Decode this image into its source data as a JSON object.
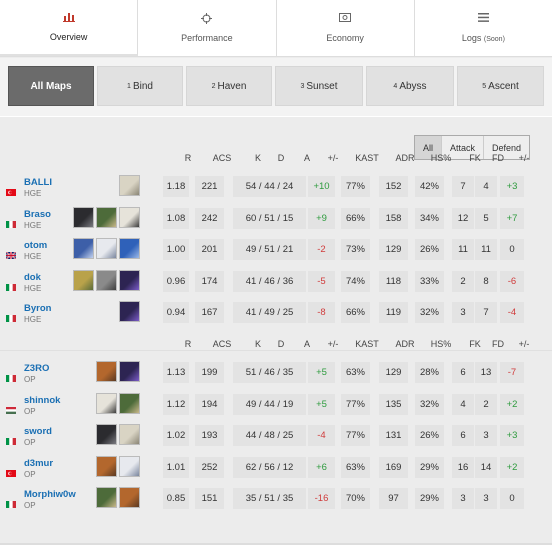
{
  "tabs": [
    {
      "label": "Overview",
      "icon": "bar-chart-icon"
    },
    {
      "label": "Performance",
      "icon": "crosshair-icon"
    },
    {
      "label": "Economy",
      "icon": "cash-icon"
    },
    {
      "label": "Logs",
      "soon": "(Soon)",
      "icon": "list-icon"
    }
  ],
  "maps": [
    {
      "num": "",
      "label": "All Maps"
    },
    {
      "num": "1",
      "label": "Bind"
    },
    {
      "num": "2",
      "label": "Haven"
    },
    {
      "num": "3",
      "label": "Sunset"
    },
    {
      "num": "4",
      "label": "Abyss"
    },
    {
      "num": "5",
      "label": "Ascent"
    }
  ],
  "filter": {
    "all": "All",
    "attack": "Attack",
    "defend": "Defend"
  },
  "columns": {
    "r": "R",
    "acs": "ACS",
    "k": "K",
    "d": "D",
    "a": "A",
    "pm": "+/-",
    "kast": "KAST",
    "adr": "ADR",
    "hs": "HS%",
    "fk": "FK",
    "fd": "FD",
    "fpm": "+/-"
  },
  "teams": [
    {
      "players": [
        {
          "name": "BALLI",
          "team": "HGE",
          "flag": "tr",
          "agents": [
            "agent-light"
          ],
          "r": "1.18",
          "acs": "221",
          "kda": "54 / 44 / 24",
          "pm": "+10",
          "kast": "77%",
          "adr": "152",
          "hs": "42%",
          "fk": "7",
          "fd": "4",
          "fpm": "+3"
        },
        {
          "name": "Braso",
          "team": "HGE",
          "flag": "it",
          "agents": [
            "agent-dark",
            "agent-green",
            "agent-mask"
          ],
          "r": "1.08",
          "acs": "242",
          "kda": "60 / 51 / 15",
          "pm": "+9",
          "kast": "66%",
          "adr": "158",
          "hs": "34%",
          "fk": "12",
          "fd": "5",
          "fpm": "+7"
        },
        {
          "name": "otom",
          "team": "HGE",
          "flag": "gb",
          "agents": [
            "agent-blue",
            "agent-white",
            "agent-blue2"
          ],
          "r": "1.00",
          "acs": "201",
          "kda": "49 / 51 / 21",
          "pm": "-2",
          "kast": "73%",
          "adr": "129",
          "hs": "26%",
          "fk": "11",
          "fd": "11",
          "fpm": "0"
        },
        {
          "name": "dok",
          "team": "HGE",
          "flag": "it",
          "agents": [
            "agent-yellow",
            "agent-grey",
            "agent-purple"
          ],
          "r": "0.96",
          "acs": "174",
          "kda": "41 / 46 / 36",
          "pm": "-5",
          "kast": "74%",
          "adr": "118",
          "hs": "33%",
          "fk": "2",
          "fd": "8",
          "fpm": "-6"
        },
        {
          "name": "Byron",
          "team": "HGE",
          "flag": "it",
          "agents": [
            "agent-purple"
          ],
          "r": "0.94",
          "acs": "167",
          "kda": "41 / 49 / 25",
          "pm": "-8",
          "kast": "66%",
          "adr": "119",
          "hs": "32%",
          "fk": "3",
          "fd": "7",
          "fpm": "-4"
        }
      ]
    },
    {
      "players": [
        {
          "name": "Z3RO",
          "team": "OP",
          "flag": "it",
          "agents": [
            "agent-orange",
            "agent-purple"
          ],
          "r": "1.13",
          "acs": "199",
          "kda": "51 / 46 / 35",
          "pm": "+5",
          "kast": "63%",
          "adr": "129",
          "hs": "28%",
          "fk": "6",
          "fd": "13",
          "fpm": "-7"
        },
        {
          "name": "shinnok",
          "team": "OP",
          "flag": "hu",
          "agents": [
            "agent-mask",
            "agent-green"
          ],
          "r": "1.12",
          "acs": "194",
          "kda": "49 / 44 / 19",
          "pm": "+5",
          "kast": "77%",
          "adr": "135",
          "hs": "32%",
          "fk": "4",
          "fd": "2",
          "fpm": "+2"
        },
        {
          "name": "sword",
          "team": "OP",
          "flag": "it",
          "agents": [
            "agent-dark",
            "agent-light"
          ],
          "r": "1.02",
          "acs": "193",
          "kda": "44 / 48 / 25",
          "pm": "-4",
          "kast": "77%",
          "adr": "131",
          "hs": "26%",
          "fk": "6",
          "fd": "3",
          "fpm": "+3"
        },
        {
          "name": "d3mur",
          "team": "OP",
          "flag": "tr",
          "agents": [
            "agent-orange",
            "agent-white"
          ],
          "r": "1.01",
          "acs": "252",
          "kda": "62 / 56 / 12",
          "pm": "+6",
          "kast": "63%",
          "adr": "169",
          "hs": "29%",
          "fk": "16",
          "fd": "14",
          "fpm": "+2"
        },
        {
          "name": "Morphiw0w",
          "team": "OP",
          "flag": "it",
          "agents": [
            "agent-green",
            "agent-orange"
          ],
          "r": "0.85",
          "acs": "151",
          "kda": "35 / 51 / 35",
          "pm": "-16",
          "kast": "70%",
          "adr": "97",
          "hs": "29%",
          "fk": "3",
          "fd": "3",
          "fpm": "0"
        }
      ]
    }
  ]
}
